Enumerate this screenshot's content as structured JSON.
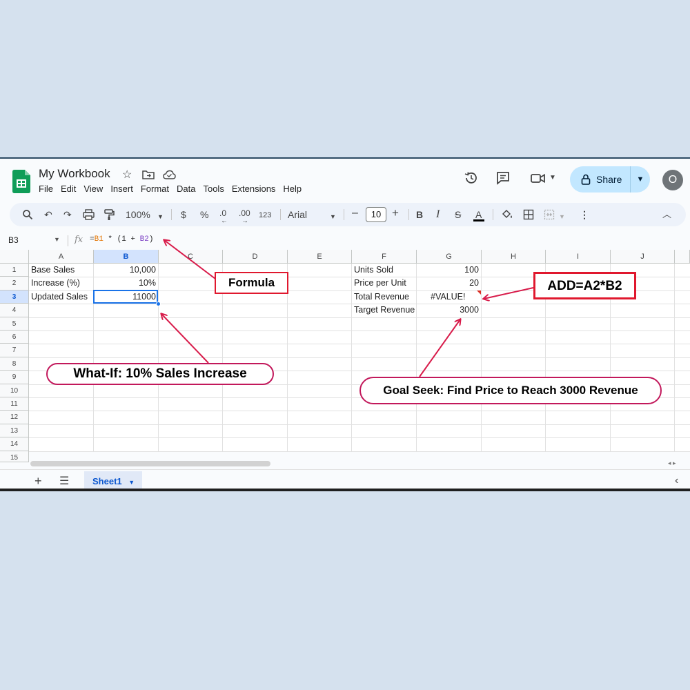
{
  "app": {
    "title": "My Workbook",
    "menu": [
      "File",
      "Edit",
      "View",
      "Insert",
      "Format",
      "Data",
      "Tools",
      "Extensions",
      "Help"
    ],
    "share_label": "Share",
    "avatar_letter": "O"
  },
  "toolbar": {
    "zoom": "100%",
    "currency": "$",
    "percent": "%",
    "decrease_decimal": ".0",
    "increase_decimal": ".00",
    "number_format": "123",
    "font": "Arial",
    "font_size": "10"
  },
  "formula_bar": {
    "cell_ref": "B3",
    "fx": "fx",
    "formula_parts": [
      "=",
      "B1",
      " * (1 + ",
      "B2",
      ")"
    ]
  },
  "sheet": {
    "columns": [
      "A",
      "B",
      "C",
      "D",
      "E",
      "F",
      "G",
      "H",
      "I",
      "J"
    ],
    "rows": [
      "1",
      "2",
      "3",
      "4",
      "5",
      "6",
      "7",
      "8",
      "9",
      "10",
      "11",
      "12",
      "13",
      "14",
      "15"
    ],
    "selected_column": "B",
    "selected_row": "3",
    "cells": {
      "A1": "Base Sales",
      "B1": "10,000",
      "A2": "Increase (%)",
      "B2": "10%",
      "A3": "Updated Sales",
      "B3": "11000",
      "F1": "Units Sold",
      "G1": "100",
      "F2": "Price per Unit",
      "G2": "20",
      "F3": "Total Revenue",
      "G3": "#VALUE!",
      "F4": "Target Revenue",
      "G4": "3000"
    },
    "tab_name": "Sheet1"
  },
  "annotations": {
    "formula": "Formula",
    "add_formula": "ADD=A2*B2",
    "what_if": "What-If: 10% Sales Increase",
    "goal_seek": "Goal Seek: Find Price to Reach 3000 Revenue"
  },
  "colors": {
    "brand_green": "#0f9d58",
    "selection_blue": "#1a73e8",
    "share_bg": "#c2e7ff",
    "callout_red": "#e0182e",
    "arrow_crimson": "#d81b4a"
  }
}
